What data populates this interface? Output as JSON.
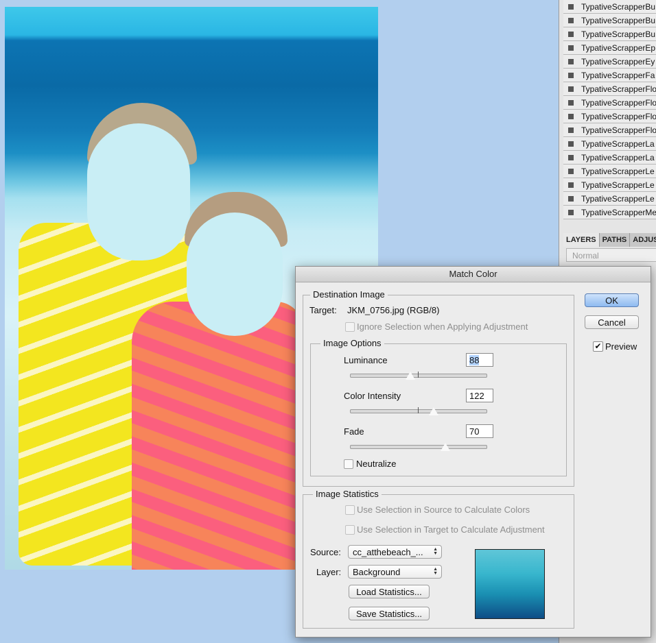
{
  "layers": {
    "items": [
      "TypativeScrapperBu",
      "TypativeScrapperBu",
      "TypativeScrapperBu",
      "TypativeScrapperEp",
      "TypativeScrapperEy",
      "TypativeScrapperFa",
      "TypativeScrapperFlo",
      "TypativeScrapperFlo",
      "TypativeScrapperFlo",
      "TypativeScrapperFlo",
      "TypativeScrapperLa",
      "TypativeScrapperLa",
      "TypativeScrapperLe",
      "TypativeScrapperLe",
      "TypativeScrapperLe",
      "TypativeScrapperMe"
    ],
    "tabs": [
      "LAYERS",
      "PATHS",
      "ADJUS"
    ],
    "blend_mode": "Normal"
  },
  "dialog": {
    "title": "Match Color",
    "ok_label": "OK",
    "cancel_label": "Cancel",
    "preview_label": "Preview",
    "preview_checked": true,
    "destination": {
      "legend": "Destination Image",
      "target_label": "Target:",
      "target_value": "JKM_0756.jpg (RGB/8)",
      "ignore_selection_label": "Ignore Selection when Applying Adjustment"
    },
    "image_options": {
      "legend": "Image Options",
      "luminance_label": "Luminance",
      "luminance_value": "88",
      "color_intensity_label": "Color Intensity",
      "color_intensity_value": "122",
      "fade_label": "Fade",
      "fade_value": "70",
      "neutralize_label": "Neutralize"
    },
    "image_statistics": {
      "legend": "Image Statistics",
      "use_source_label": "Use Selection in Source to Calculate Colors",
      "use_target_label": "Use Selection in Target to Calculate Adjustment",
      "source_label": "Source:",
      "source_value": "cc_atthebeach_...",
      "layer_label": "Layer:",
      "layer_value": "Background",
      "load_label": "Load Statistics...",
      "save_label": "Save Statistics..."
    }
  }
}
